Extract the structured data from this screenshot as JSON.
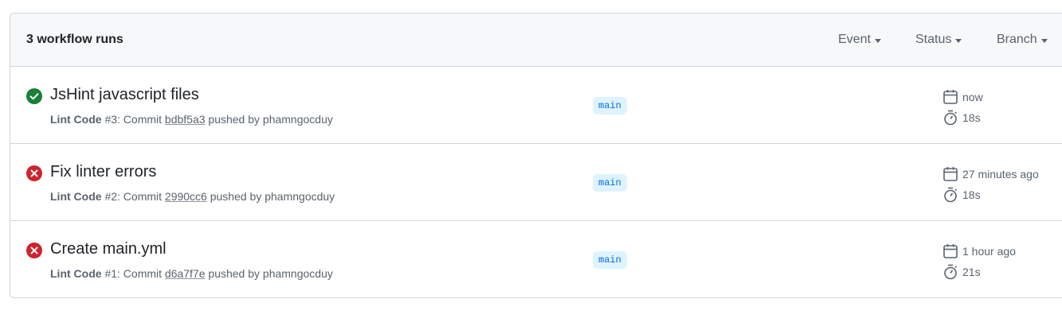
{
  "header": {
    "runs_count": "3 workflow runs",
    "filters": [
      {
        "label": "Event"
      },
      {
        "label": "Status"
      },
      {
        "label": "Branch"
      }
    ]
  },
  "runs": [
    {
      "title": "JsHint javascript files",
      "status": "success",
      "workflow": "Lint Code",
      "run_number": "#3",
      "commit_prefix": ": Commit ",
      "sha": "bdbf5a3",
      "pushed_by": " pushed by phamngocduy",
      "branch": "main",
      "time": "now",
      "duration": "18s"
    },
    {
      "title": "Fix linter errors",
      "status": "failure",
      "workflow": "Lint Code",
      "run_number": "#2",
      "commit_prefix": ": Commit ",
      "sha": "2990cc6",
      "pushed_by": " pushed by phamngocduy",
      "branch": "main",
      "time": "27 minutes ago",
      "duration": "18s"
    },
    {
      "title": "Create main.yml",
      "status": "failure",
      "workflow": "Lint Code",
      "run_number": "#1",
      "commit_prefix": ": Commit ",
      "sha": "d6a7f7e",
      "pushed_by": " pushed by phamngocduy",
      "branch": "main",
      "time": "1 hour ago",
      "duration": "21s"
    }
  ],
  "colors": {
    "success": "#1a7f37",
    "failure": "#cf222e",
    "branch_bg": "#ddf4ff",
    "branch_fg": "#0969da"
  }
}
